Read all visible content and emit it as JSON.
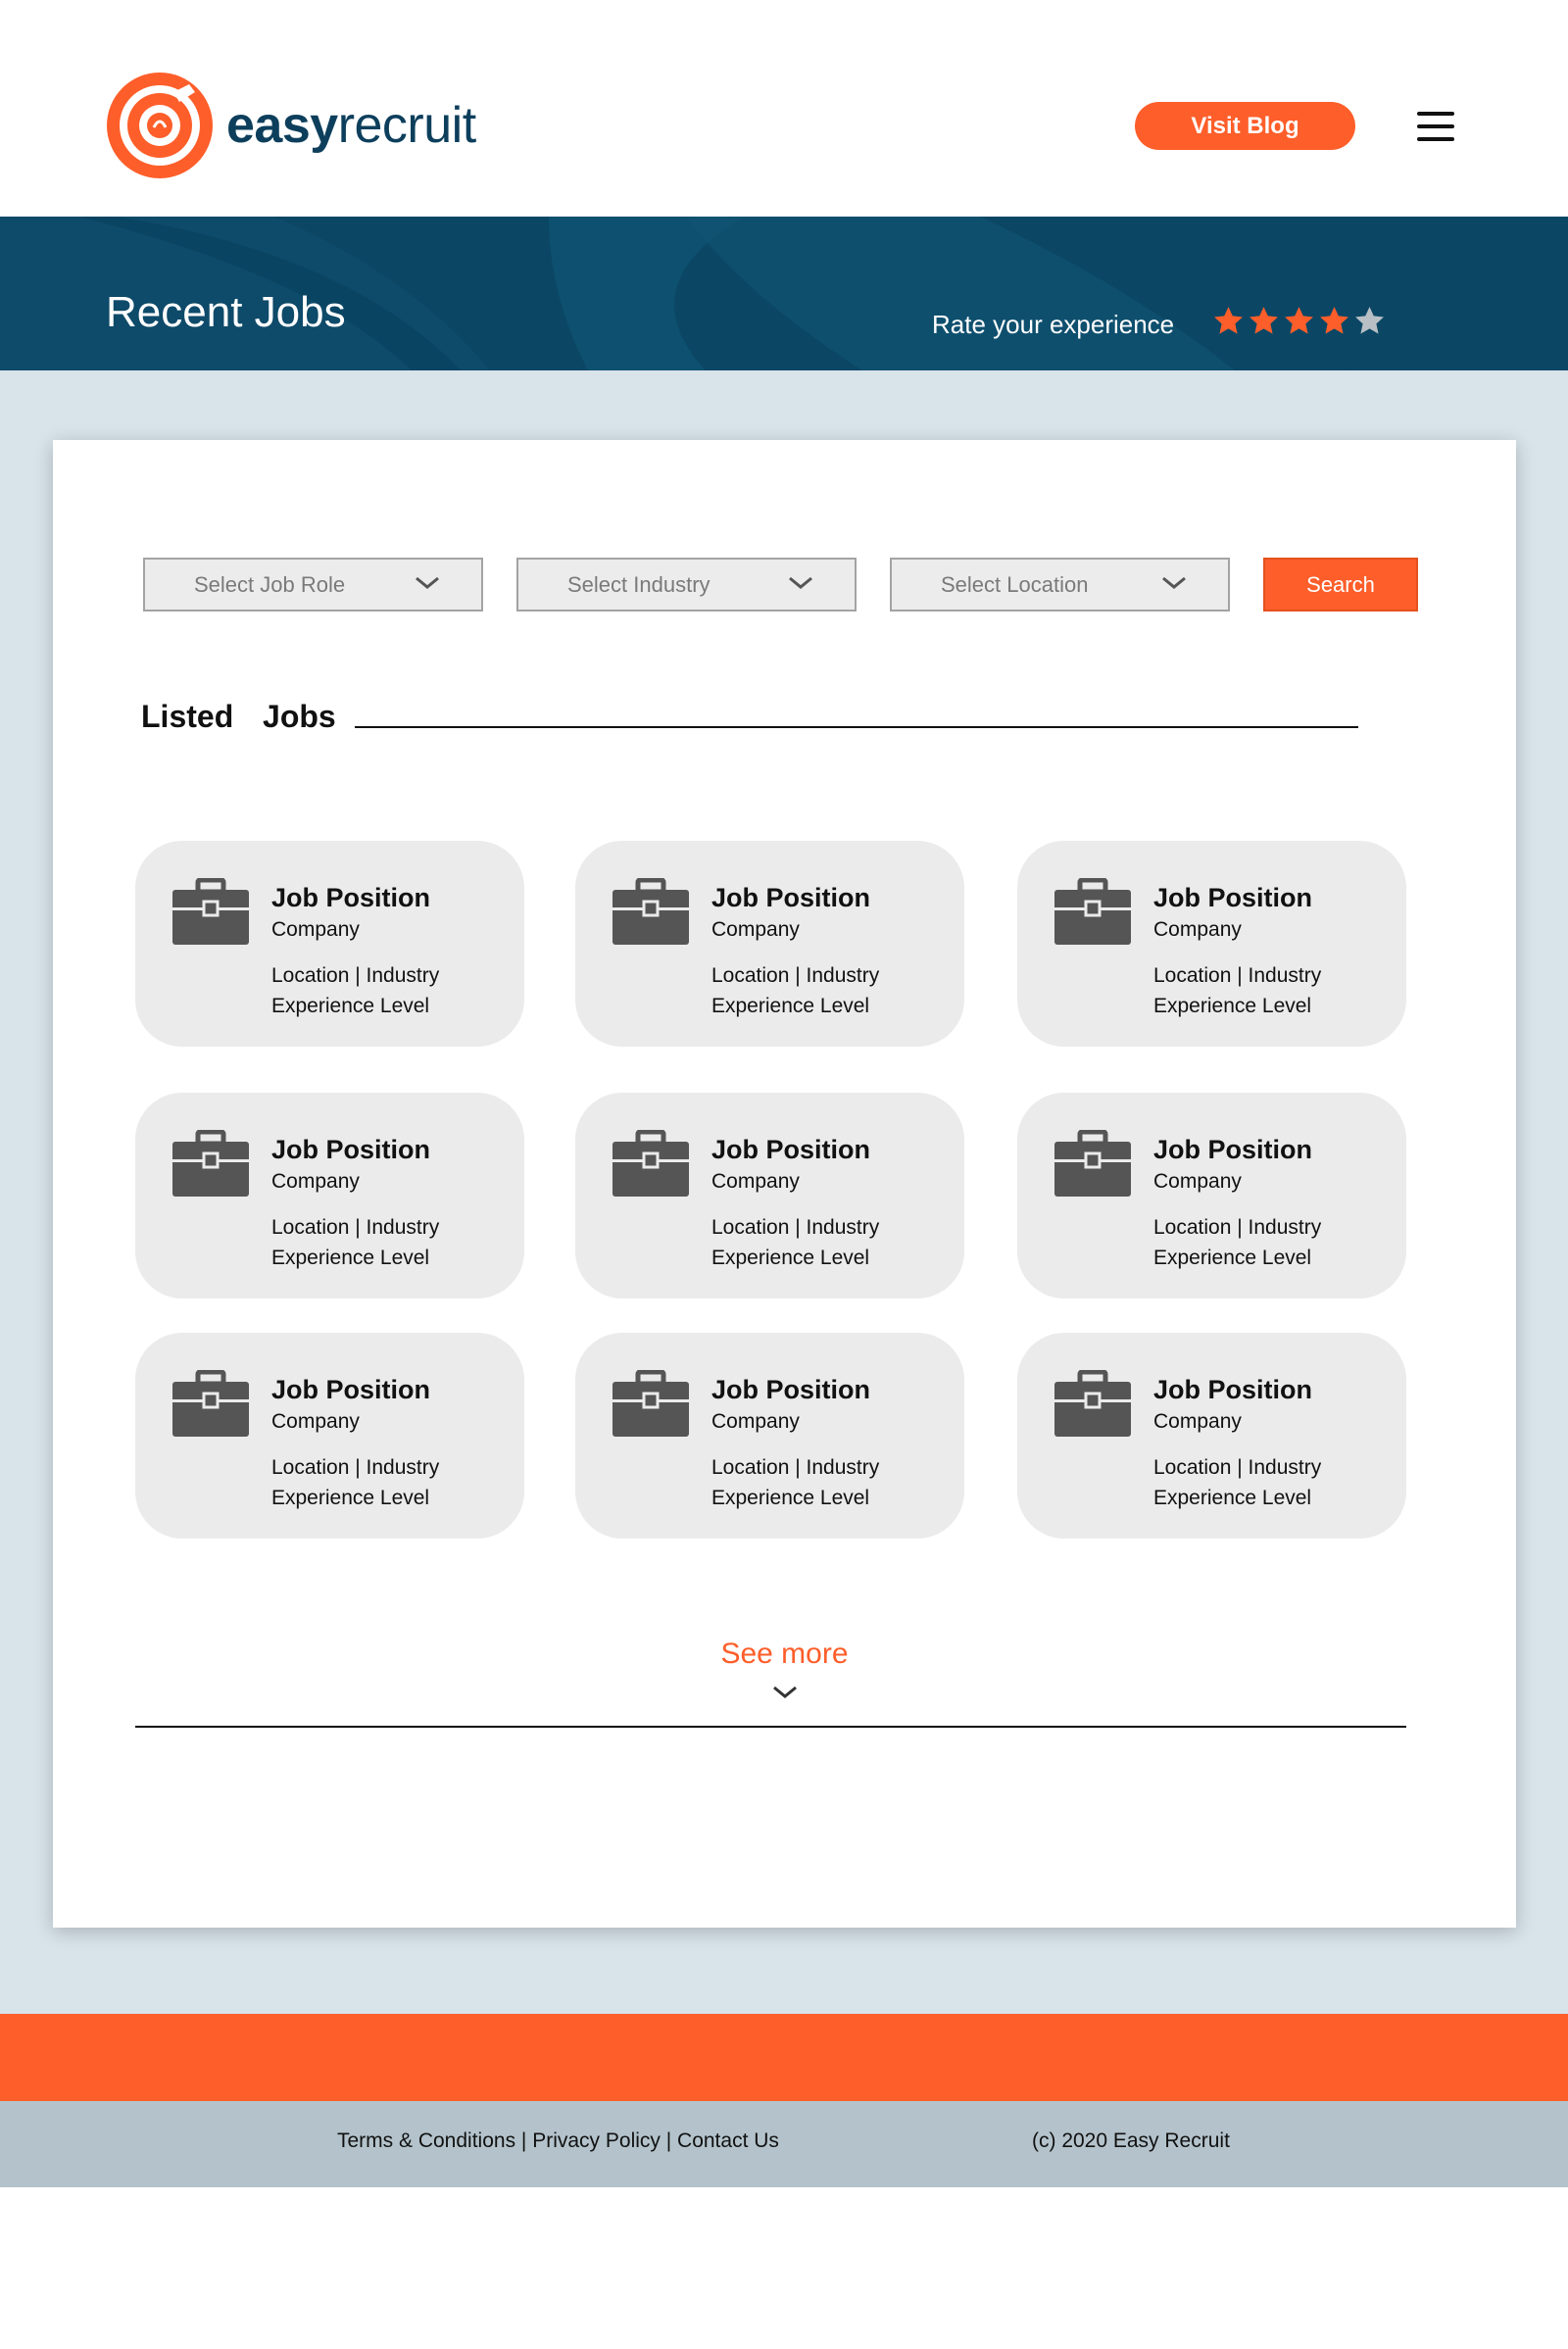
{
  "brand": {
    "bold": "easy",
    "light": "recruit"
  },
  "header": {
    "visit_blog_label": "Visit Blog",
    "menu_icon": "hamburger-icon"
  },
  "banner": {
    "title": "Recent Jobs",
    "rate_label": "Rate your experience",
    "rating": {
      "value": 4,
      "max": 5,
      "filled_color": "#fe5e2a",
      "empty_color": "#b8c0c5"
    }
  },
  "filters": {
    "job_role_placeholder": "Select Job Role",
    "industry_placeholder": "Select Industry",
    "location_placeholder": "Select Location",
    "search_label": "Search"
  },
  "listed": {
    "title": "Listed  Jobs"
  },
  "jobs": [
    {
      "position": "Job Position",
      "company": "Company",
      "location": "Location",
      "industry": "Industry",
      "experience": "Experience Level"
    },
    {
      "position": "Job Position",
      "company": "Company",
      "location": "Location",
      "industry": "Industry",
      "experience": "Experience Level"
    },
    {
      "position": "Job Position",
      "company": "Company",
      "location": "Location",
      "industry": "Industry",
      "experience": "Experience Level"
    },
    {
      "position": "Job Position",
      "company": "Company",
      "location": "Location",
      "industry": "Industry",
      "experience": "Experience Level"
    },
    {
      "position": "Job Position",
      "company": "Company",
      "location": "Location",
      "industry": "Industry",
      "experience": "Experience Level"
    },
    {
      "position": "Job Position",
      "company": "Company",
      "location": "Location",
      "industry": "Industry",
      "experience": "Experience Level"
    },
    {
      "position": "Job Position",
      "company": "Company",
      "location": "Location",
      "industry": "Industry",
      "experience": "Experience Level"
    },
    {
      "position": "Job Position",
      "company": "Company",
      "location": "Location",
      "industry": "Industry",
      "experience": "Experience Level"
    },
    {
      "position": "Job Position",
      "company": "Company",
      "location": "Location",
      "industry": "Industry",
      "experience": "Experience Level"
    }
  ],
  "see_more": {
    "label": "See more"
  },
  "footer": {
    "links": [
      "Terms & Conditions",
      "Privacy Policy",
      "Contact Us"
    ],
    "separator": " | ",
    "copyright": "(c) 2020 Easy Recruit"
  },
  "colors": {
    "accent": "#fe5e2a",
    "navy": "#0b4765",
    "page_bg": "#d8e3ea",
    "footer_grey": "#b4c3cb"
  }
}
